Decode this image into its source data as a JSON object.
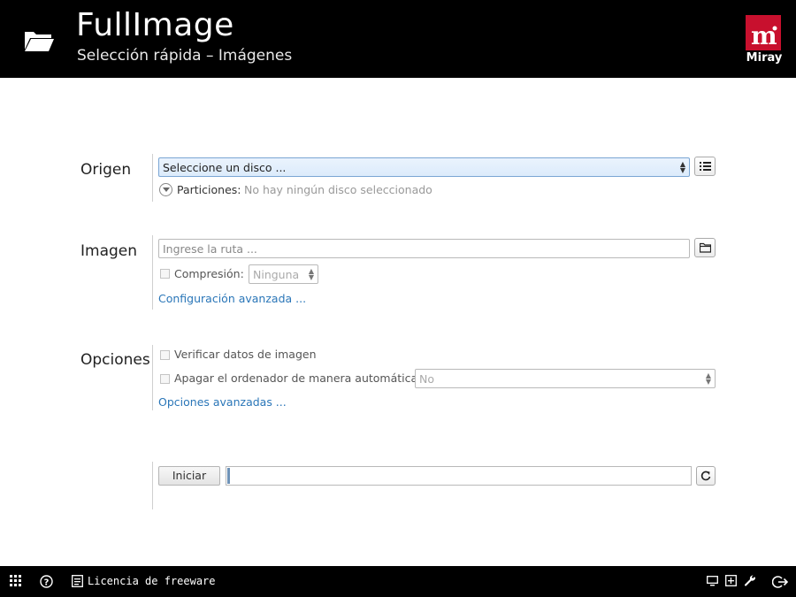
{
  "header": {
    "title": "FullImage",
    "subtitle": "Selección rápida – Imágenes",
    "logo_text": "Miray",
    "logo_mark": "m",
    "icon": "folder-open-icon",
    "background": "#000000",
    "brand_color": "#c8102e"
  },
  "origin": {
    "label": "Origen",
    "disk_select_value": "Seleccione un disco ...",
    "partitions_label": "Particiones:",
    "partitions_value": "No hay ningún disco seleccionado",
    "list_button_icon": "list-icon"
  },
  "image": {
    "label": "Imagen",
    "path_placeholder": "Ingrese la ruta ...",
    "browse_icon": "folder-icon",
    "compression_label": "Compresión:",
    "compression_value": "Ninguna",
    "advanced_link": "Configuración avanzada ..."
  },
  "options": {
    "label": "Opciones",
    "verify_label": "Verificar datos de imagen",
    "shutdown_label": "Apagar el ordenador de manera automática:",
    "shutdown_value": "No",
    "advanced_link": "Opciones avanzadas ..."
  },
  "actions": {
    "start_label": "Iniciar",
    "progress_fraction": 0.006,
    "refresh_icon": "refresh-icon",
    "accent": "#2a76b8"
  },
  "footer": {
    "license_text": "Licencia de freeware",
    "icons": [
      "grid-icon",
      "help-icon",
      "license-icon",
      "monitor-icon",
      "add-icon",
      "wrench-icon",
      "exit-icon"
    ]
  }
}
